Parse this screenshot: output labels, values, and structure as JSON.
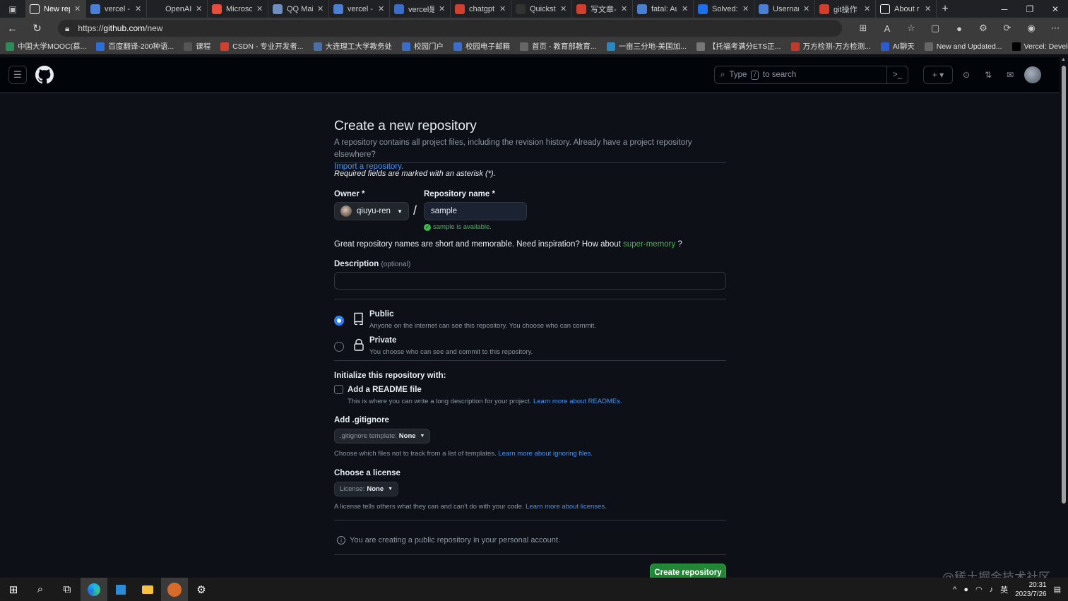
{
  "browser": {
    "tabs": [
      {
        "label": "New rep",
        "color": "#ffffff",
        "icon": "github-icon",
        "active": true
      },
      {
        "label": "vercel - ",
        "color": "#4a7fd4",
        "icon": "search-icon"
      },
      {
        "label": "OpenAI",
        "color": "#202124",
        "icon": "openai-icon"
      },
      {
        "label": "Microso",
        "color": "#e74c3c",
        "icon": "microsoft-icon"
      },
      {
        "label": "QQ Mail",
        "color": "#6c8fbf",
        "icon": "mail-icon"
      },
      {
        "label": "vercel - ",
        "color": "#4a7fd4",
        "icon": "search-icon"
      },
      {
        "label": "vercel是",
        "color": "#3a6ec8",
        "icon": "translate-icon"
      },
      {
        "label": "chatgpt",
        "color": "#d13f2f",
        "icon": "csdn-icon"
      },
      {
        "label": "Quicksta",
        "color": "#333333",
        "icon": "vercel-icon"
      },
      {
        "label": "写文章-",
        "color": "#d13f2f",
        "icon": "csdn-icon"
      },
      {
        "label": "fatal: Au",
        "color": "#4a7fd4",
        "icon": "search-icon"
      },
      {
        "label": "Solved:",
        "color": "#1f6feb",
        "icon": "atlassian-icon"
      },
      {
        "label": "Usernan",
        "color": "#4a7fd4",
        "icon": "search-icon"
      },
      {
        "label": "git操作",
        "color": "#d13f2f",
        "icon": "csdn-icon"
      },
      {
        "label": "About r",
        "color": "#ffffff",
        "icon": "github-icon"
      }
    ],
    "url_prefix": "https://",
    "url_host": "github.com",
    "url_path": "/new",
    "bookmarks": [
      {
        "label": "中国大学MOOC(慕...",
        "color": "#2e8b57"
      },
      {
        "label": "百度翻译-200种语...",
        "color": "#2b6fd6"
      },
      {
        "label": "课程",
        "color": "#555555"
      },
      {
        "label": "CSDN - 专业开发者...",
        "color": "#d13f2f"
      },
      {
        "label": "大连理工大学教务处",
        "color": "#4a6fa5"
      },
      {
        "label": "校园门户",
        "color": "#3a6ec8"
      },
      {
        "label": "校园电子邮箱",
        "color": "#3a6ec8"
      },
      {
        "label": "首页 - 教育部教育...",
        "color": "#666666"
      },
      {
        "label": "一亩三分地-美国加...",
        "color": "#2e86c1"
      },
      {
        "label": "【托福考满分ETS正...",
        "color": "#777777"
      },
      {
        "label": "万方检测-万方检测...",
        "color": "#c0392b"
      },
      {
        "label": "AI聊天",
        "color": "#2e5ad1"
      },
      {
        "label": "New and Updated...",
        "color": "#666666"
      },
      {
        "label": "Vercel: Develop. Pre...",
        "color": "#000000"
      }
    ]
  },
  "github": {
    "search_prefix": "Type",
    "search_key": "/",
    "search_suffix": "to search"
  },
  "form": {
    "title": "Create a new repository",
    "subtitle": "A repository contains all project files, including the revision history. Already have a project repository elsewhere?",
    "import_link": "Import a repository.",
    "required_note": "Required fields are marked with an asterisk (*).",
    "owner_label": "Owner *",
    "owner_value": "qiuyu-ren",
    "repo_label": "Repository name *",
    "repo_value": "sample",
    "available_msg": "sample is available.",
    "inspire_text": "Great repository names are short and memorable. Need inspiration? How about",
    "inspire_suggestion": "super-memory",
    "inspire_end": "?",
    "description_label": "Description",
    "description_optional": "(optional)",
    "description_value": "",
    "visibility": [
      {
        "title": "Public",
        "desc": "Anyone on the internet can see this repository. You choose who can commit.",
        "checked": true
      },
      {
        "title": "Private",
        "desc": "You choose who can see and commit to this repository.",
        "checked": false
      }
    ],
    "init_label": "Initialize this repository with:",
    "readme_label": "Add a README file",
    "readme_desc": "This is where you can write a long description for your project.",
    "readme_link": "Learn more about READMEs.",
    "gitignore_label": "Add .gitignore",
    "gitignore_select_prefix": ".gitignore template:",
    "gitignore_select_value": "None",
    "gitignore_desc": "Choose which files not to track from a list of templates.",
    "gitignore_link": "Learn more about ignoring files.",
    "license_label": "Choose a license",
    "license_select_prefix": "License:",
    "license_select_value": "None",
    "license_desc": "A license tells others what they can and can't do with your code.",
    "license_link": "Learn more about licenses.",
    "info_note": "You are creating a public repository in your personal account.",
    "create_button": "Create repository"
  },
  "taskbar": {
    "time": "20:31",
    "date": "2023/7/26",
    "lang": "英"
  },
  "watermark": "@稀土掘金技术社区"
}
